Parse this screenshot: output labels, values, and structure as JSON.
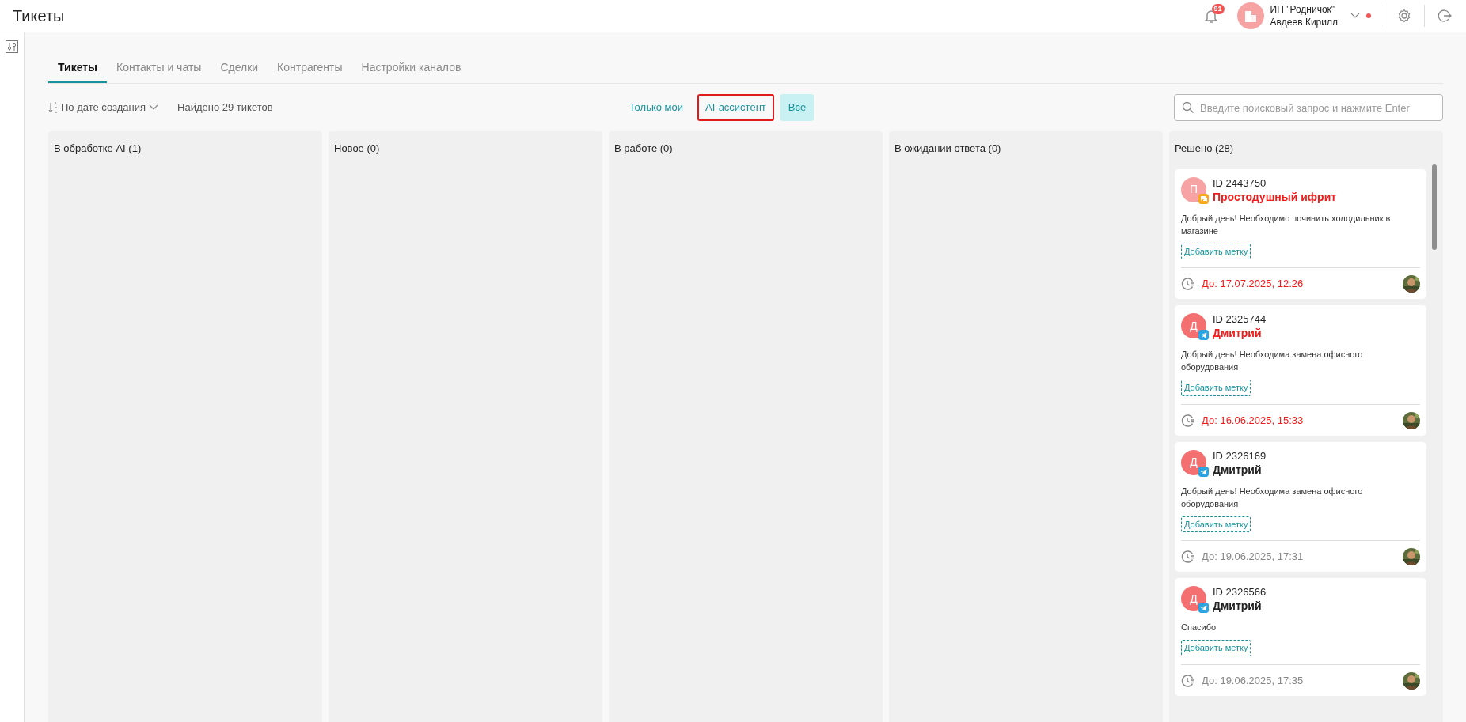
{
  "header": {
    "title": "Тикеты",
    "notifications": "91",
    "org": "ИП \"Родничок\"",
    "user": "Авдеев Кирилл"
  },
  "tabs": [
    {
      "label": "Тикеты",
      "selected": true
    },
    {
      "label": "Контакты и чаты",
      "selected": false
    },
    {
      "label": "Сделки",
      "selected": false
    },
    {
      "label": "Контрагенты",
      "selected": false
    },
    {
      "label": "Настройки каналов",
      "selected": false
    }
  ],
  "toolbar": {
    "sort": "По дате создания",
    "found": "Найдено 29 тикетов",
    "search": {
      "placeholder": "Введите поисковый запрос и нажмите Enter"
    }
  },
  "filters": [
    {
      "label": "Только мои",
      "selected": false,
      "highlighted": false
    },
    {
      "label": "AI-ассистент",
      "selected": false,
      "highlighted": true
    },
    {
      "label": "Все",
      "selected": true,
      "highlighted": false
    }
  ],
  "columns": [
    {
      "title": "В обработке AI (1)"
    },
    {
      "title": "Новое (0)"
    },
    {
      "title": "В работе (0)"
    },
    {
      "title": "В ожидании ответа (0)"
    },
    {
      "title": "Решено (28)",
      "tickets": [
        {
          "initial": "П",
          "color": "#f7a3a3",
          "kind": "chat",
          "id": "ID 2443750",
          "name": "Простодушный ифрит",
          "message": "Добрый день! Необходимо починить холодильник в магазине",
          "tag": "Добавить метку",
          "deadline": "До: 17.07.2025, 12:26",
          "overdue": true
        },
        {
          "initial": "Д",
          "color": "#f47070",
          "kind": "telegram",
          "id": "ID 2325744",
          "name": "Дмитрий",
          "message": "Добрый день! Необходима замена офисного оборудования",
          "tag": "Добавить метку",
          "deadline": "До: 16.06.2025, 15:33",
          "overdue": true
        },
        {
          "initial": "Д",
          "color": "#f47070",
          "kind": "telegram",
          "id": "ID 2326169",
          "name": "Дмитрий",
          "message": "Добрый день! Необходима замена офисного оборудования",
          "tag": "Добавить метку",
          "deadline": "До: 19.06.2025, 17:31",
          "overdue": false
        },
        {
          "initial": "Д",
          "color": "#f47070",
          "kind": "telegram",
          "id": "ID 2326566",
          "name": "Дмитрий",
          "message": "Спасибо",
          "tag": "Добавить метку",
          "deadline": "До: 19.06.2025, 17:35",
          "overdue": false
        }
      ]
    }
  ]
}
